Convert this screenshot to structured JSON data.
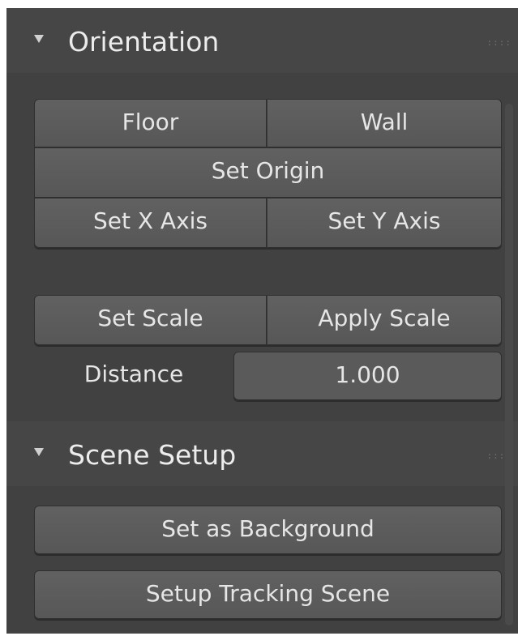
{
  "orientation": {
    "title": "Orientation",
    "grip": "::::",
    "floor_label": "Floor",
    "wall_label": "Wall",
    "set_origin_label": "Set Origin",
    "set_x_axis_label": "Set X Axis",
    "set_y_axis_label": "Set Y Axis",
    "set_scale_label": "Set Scale",
    "apply_scale_label": "Apply Scale",
    "distance_label": "Distance",
    "distance_value": "1.000"
  },
  "scene_setup": {
    "title": "Scene Setup",
    "grip": "::::",
    "set_background_label": "Set as Background",
    "setup_tracking_label": "Setup Tracking Scene"
  },
  "colors": {
    "panel_bg": "#3d3d3d",
    "header_bg": "#464646",
    "button_bg": "#5e5e5e",
    "text": "#e6e6e6"
  }
}
